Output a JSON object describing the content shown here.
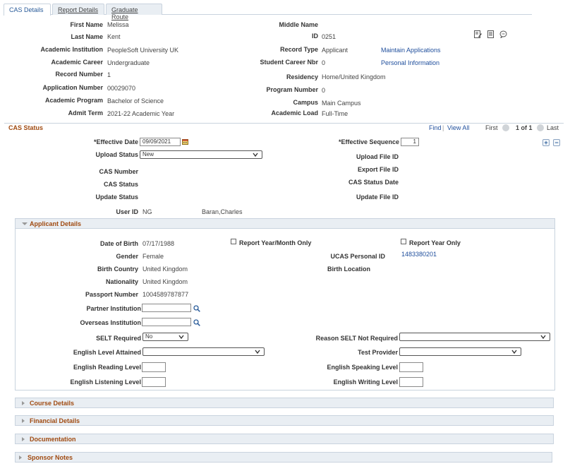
{
  "tabs": [
    {
      "label": "CAS Details"
    },
    {
      "label": "Report Details"
    },
    {
      "label": "Graduate Route"
    }
  ],
  "header": {
    "first_name_label": "First Name",
    "first_name": "Melissa",
    "last_name_label": "Last Name",
    "last_name": "Kent",
    "institution_label": "Academic Institution",
    "institution": "PeopleSoft University UK",
    "career_label": "Academic Career",
    "career": "Undergraduate",
    "record_number_label": "Record Number",
    "record_number": "1",
    "application_number_label": "Application Number",
    "application_number": "00029070",
    "program_label": "Academic Program",
    "program": "Bachelor of Science",
    "admit_term_label": "Admit Term",
    "admit_term": "2021-22 Academic Year",
    "middle_name_label": "Middle Name",
    "middle_name": "",
    "id_label": "ID",
    "id": "0251",
    "record_type_label": "Record Type",
    "record_type": "Applicant",
    "student_career_nbr_label": "Student Career Nbr",
    "student_career_nbr": "0",
    "residency_label": "Residency",
    "residency": "Home/United Kingdom",
    "program_number_label": "Program Number",
    "program_number": "0",
    "campus_label": "Campus",
    "campus": "Main Campus",
    "academic_load_label": "Academic Load",
    "academic_load": "Full-Time",
    "maintain_applications_link": "Maintain Applications",
    "personal_information_link": "Personal Information",
    "icons": [
      "edit-icon",
      "notes-icon",
      "comment-icon"
    ]
  },
  "cas_status": {
    "title": "CAS Status",
    "find_link": "Find",
    "view_all_link": "View All",
    "first_label": "First",
    "pager_text": "1 of 1",
    "last_label": "Last",
    "effective_date_label": "*Effective Date",
    "effective_date": "09/09/2021",
    "effective_sequence_label": "*Effective Sequence",
    "effective_sequence": "1",
    "upload_status_label": "Upload Status",
    "upload_status": "New",
    "upload_file_id_label": "Upload File ID",
    "cas_number_label": "CAS Number",
    "export_file_id_label": "Export File ID",
    "cas_status_label": "CAS Status",
    "cas_status_date_label": "CAS Status Date",
    "update_status_label": "Update Status",
    "update_file_id_label": "Update File ID",
    "user_id_label": "User ID",
    "user_id": "NG",
    "user_name": "Baran,Charles",
    "add_label": "+",
    "remove_label": "−"
  },
  "applicant_details": {
    "title": "Applicant Details",
    "dob_label": "Date of Birth",
    "dob": "07/17/1988",
    "report_year_month_label": "Report Year/Month Only",
    "report_year_label": "Report Year Only",
    "gender_label": "Gender",
    "gender": "Female",
    "ucas_label": "UCAS Personal ID",
    "ucas_id": "1483380201",
    "birth_country_label": "Birth Country",
    "birth_country": "United Kingdom",
    "birth_location_label": "Birth Location",
    "nationality_label": "Nationality",
    "nationality": "United Kingdom",
    "passport_label": "Passport Number",
    "passport": "1004589787877",
    "partner_label": "Partner Institution",
    "partner": "",
    "overseas_label": "Overseas Institution",
    "overseas": "",
    "selt_label": "SELT Required",
    "selt": "No",
    "reason_selt_label": "Reason SELT Not Required",
    "reason_selt": "",
    "english_level_label": "English Level Attained",
    "english_level": "",
    "test_provider_label": "Test Provider",
    "test_provider": "",
    "reading_label": "English Reading Level",
    "reading": "",
    "speaking_label": "English Speaking Level",
    "speaking": "",
    "listening_label": "English Listening Level",
    "listening": "",
    "writing_label": "English Writing Level",
    "writing": ""
  },
  "collapsed_sections": [
    {
      "title": "Course Details"
    },
    {
      "title": "Financial Details"
    },
    {
      "title": "Documentation"
    },
    {
      "title": "Sponsor Notes"
    }
  ]
}
